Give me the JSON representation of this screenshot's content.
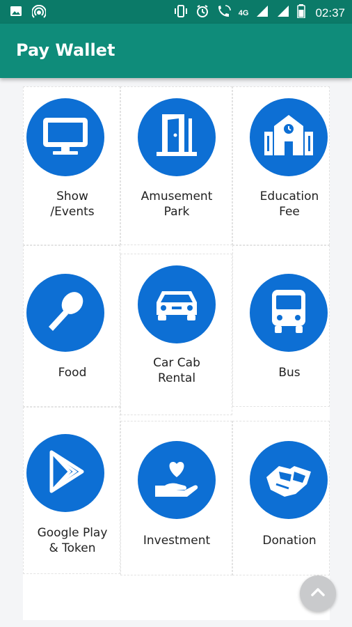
{
  "status_bar": {
    "time": "02:37",
    "network_label": "4G",
    "icons": [
      "image-icon",
      "hotspot-icon",
      "vibrate-icon",
      "alarm-icon",
      "wifi-calling-icon",
      "signal-icon",
      "signal-icon-2",
      "battery-icon"
    ]
  },
  "app_bar": {
    "title": "Pay Wallet"
  },
  "services": [
    {
      "label": "Show\n/Events",
      "icon": "monitor-icon"
    },
    {
      "label": "Amusement\nPark",
      "icon": "door-icon"
    },
    {
      "label": "Education\nFee",
      "icon": "school-icon"
    },
    {
      "label": "Food",
      "icon": "spoon-icon"
    },
    {
      "label": "Car Cab\nRental",
      "icon": "car-icon"
    },
    {
      "label": "Bus",
      "icon": "bus-icon"
    },
    {
      "label": "Google Play\n& Token",
      "icon": "play-store-icon"
    },
    {
      "label": "Investment",
      "icon": "heart-hand-icon"
    },
    {
      "label": "Donation",
      "icon": "handshake-icon"
    }
  ],
  "colors": {
    "status_bar": "#0b7a68",
    "app_bar": "#0f8c7a",
    "icon_circle": "#0d6fd4",
    "background": "#f4f5f7",
    "fab": "#c9cacc"
  },
  "fab": {
    "icon": "chevron-up-icon"
  }
}
